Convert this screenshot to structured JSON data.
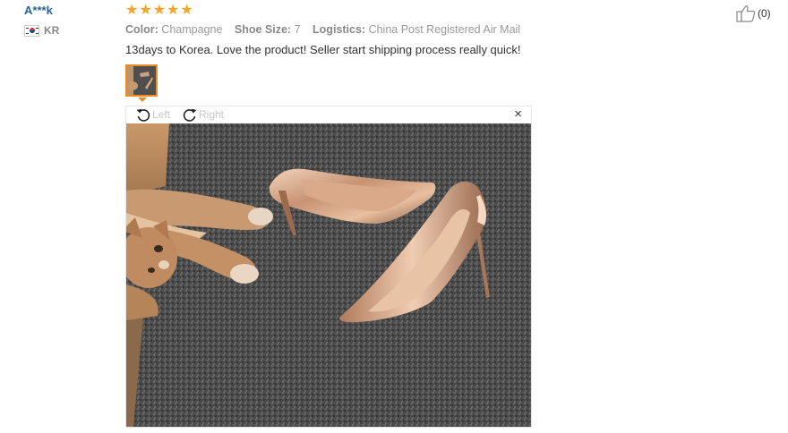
{
  "reviewer": {
    "name": "A***k",
    "country_code": "KR"
  },
  "rating": {
    "stars": 5,
    "max": 5,
    "color": "#f5a623"
  },
  "attributes": [
    {
      "label": "Color:",
      "value": "Champagne"
    },
    {
      "label": "Shoe Size:",
      "value": "7"
    },
    {
      "label": "Logistics:",
      "value": "China Post Registered Air Mail"
    }
  ],
  "review_text": "13days to Korea. Love the product! Seller start shipping process really quick!",
  "viewer": {
    "rotate_left_label": "Left",
    "rotate_right_label": "Right",
    "close_symbol": "×",
    "photo_icon": "photo of champagne high heels and cat on gray rug"
  },
  "helpful": {
    "count_label": "(0)",
    "icon": "thumbs-up-icon"
  },
  "colors": {
    "name_link": "#2a6496",
    "accent": "#f08a24",
    "muted": "#888888"
  }
}
